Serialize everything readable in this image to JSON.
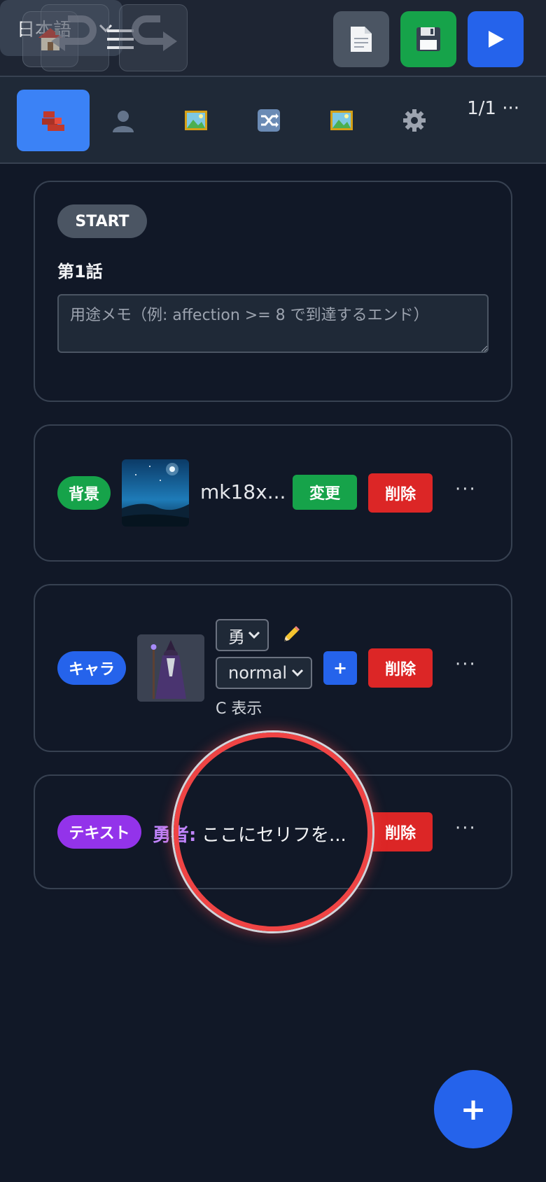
{
  "toolbar": {
    "home_icon": "house-icon",
    "language": "日本語",
    "file_icon": "document-icon",
    "save_icon": "floppy-disk-icon",
    "play_icon": "play-icon",
    "colors": {
      "save": "#16a34a",
      "play": "#2563eb"
    }
  },
  "tabs": [
    {
      "icon": "bricks-icon",
      "active": true
    },
    {
      "icon": "person-icon",
      "active": false
    },
    {
      "icon": "picture-icon",
      "active": false
    },
    {
      "icon": "shuffle-icon",
      "active": false
    },
    {
      "icon": "picture-icon",
      "active": false
    },
    {
      "icon": "gear-icon",
      "active": false
    }
  ],
  "pager": {
    "text": "1/1",
    "more": "···"
  },
  "start_card": {
    "badge": "START",
    "title": "第1話",
    "memo_placeholder": "用途メモ（例: affection >= 8 で到達するエンド）"
  },
  "bg_card": {
    "badge": "背景",
    "filename": "mk18x...",
    "change_label": "変更",
    "delete_label": "削除",
    "more": "···"
  },
  "chara_card": {
    "badge": "キャラ",
    "name_select": "勇",
    "expression_select": "normal",
    "add_label": "+",
    "position_text": "C 表示",
    "delete_label": "削除",
    "more": "···"
  },
  "text_card": {
    "badge": "テキスト",
    "speaker": "勇者:",
    "line": "ここにセリフを...",
    "delete_label": "削除",
    "more": "···"
  },
  "fab": {
    "label": "+"
  }
}
